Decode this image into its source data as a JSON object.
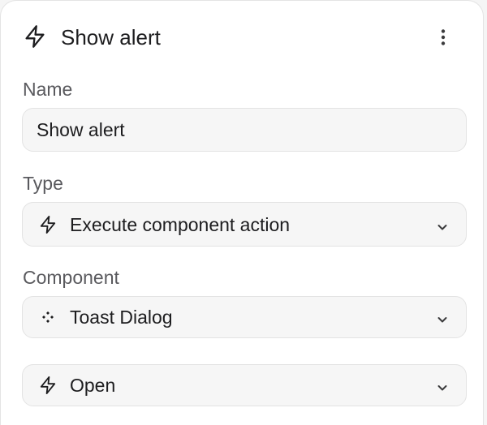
{
  "header": {
    "title": "Show alert",
    "icon": "lightning-icon",
    "menu_icon": "more-vertical-icon"
  },
  "name_field": {
    "label": "Name",
    "value": "Show alert"
  },
  "type_field": {
    "label": "Type",
    "value": "Execute component action",
    "icon": "lightning-icon"
  },
  "component_field": {
    "label": "Component",
    "value": "Toast Dialog",
    "icon": "component-icon"
  },
  "action_field": {
    "value": "Open",
    "icon": "lightning-icon"
  },
  "colors": {
    "panel_background": "#ffffff",
    "field_background": "#f6f6f6",
    "field_border": "#e3e3e3",
    "label_text": "#5a5a5e",
    "primary_text": "#1d1d1f"
  }
}
